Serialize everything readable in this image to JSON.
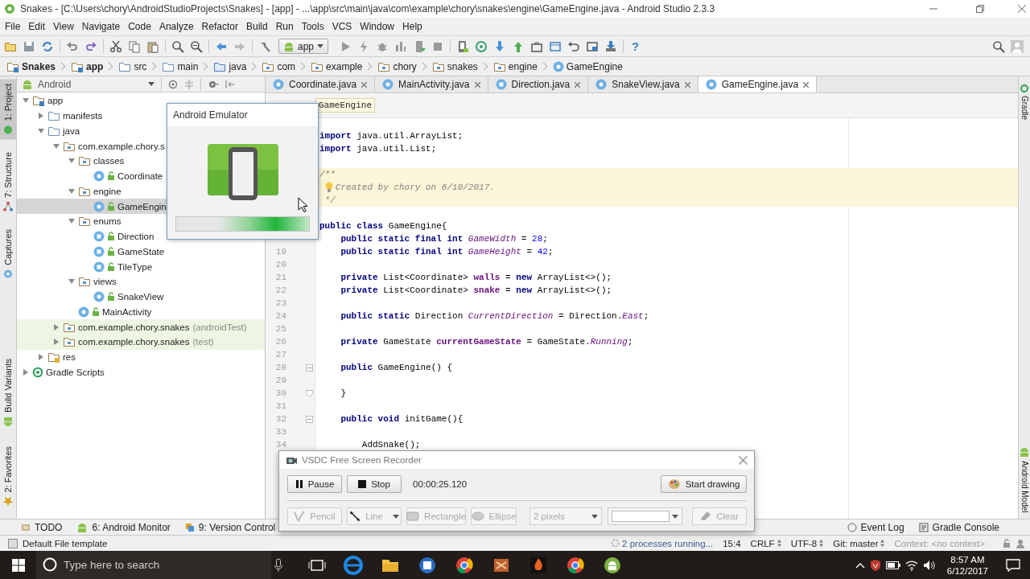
{
  "window": {
    "title": "Snakes - [C:\\Users\\chory\\AndroidStudioProjects\\Snakes] - [app] - ...\\app\\src\\main\\java\\com\\example\\chory\\snakes\\engine\\GameEngine.java - Android Studio 2.3.3"
  },
  "menu": [
    "File",
    "Edit",
    "View",
    "Navigate",
    "Code",
    "Analyze",
    "Refactor",
    "Build",
    "Run",
    "Tools",
    "VCS",
    "Window",
    "Help"
  ],
  "toolbar": {
    "run_config": "app",
    "help": "?"
  },
  "navigation_bar": [
    {
      "label": "Snakes",
      "kind": "project"
    },
    {
      "label": "app",
      "kind": "module"
    },
    {
      "label": "src",
      "kind": "folder"
    },
    {
      "label": "main",
      "kind": "folder"
    },
    {
      "label": "java",
      "kind": "source"
    },
    {
      "label": "com",
      "kind": "package"
    },
    {
      "label": "example",
      "kind": "package"
    },
    {
      "label": "chory",
      "kind": "package"
    },
    {
      "label": "snakes",
      "kind": "package"
    },
    {
      "label": "engine",
      "kind": "package"
    },
    {
      "label": "GameEngine",
      "kind": "class"
    }
  ],
  "tool_strip_left": {
    "top": [
      {
        "label": "1: Project",
        "selected": true
      },
      {
        "label": "7: Structure",
        "selected": false
      },
      {
        "label": "Captures",
        "selected": false
      }
    ],
    "bottom": [
      {
        "label": "Build Variants",
        "selected": false
      },
      {
        "label": "2: Favorites",
        "selected": false
      }
    ]
  },
  "tool_strip_right": {
    "top": [
      "Gradle"
    ],
    "bottom": [
      "Android Model"
    ]
  },
  "project_panel": {
    "view": "Android",
    "tree": [
      {
        "label": "app",
        "kind": "module",
        "expanded": true,
        "selected": false,
        "children": [
          {
            "label": "manifests",
            "kind": "folder",
            "expanded": false,
            "selected": false
          },
          {
            "label": "java",
            "kind": "folder",
            "expanded": true,
            "selected": false,
            "children": [
              {
                "label": "com.example.chory.s",
                "kind": "package",
                "expanded": true,
                "selected": false,
                "children": [
                  {
                    "label": "classes",
                    "kind": "package",
                    "expanded": true,
                    "selected": false,
                    "children": [
                      {
                        "label": "Coordinate",
                        "kind": "class",
                        "selected": false
                      }
                    ]
                  },
                  {
                    "label": "engine",
                    "kind": "package",
                    "expanded": true,
                    "selected": false,
                    "children": [
                      {
                        "label": "GameEngin",
                        "kind": "class",
                        "selected": true
                      }
                    ]
                  },
                  {
                    "label": "enums",
                    "kind": "package",
                    "expanded": true,
                    "selected": false,
                    "children": [
                      {
                        "label": "Direction",
                        "kind": "enum",
                        "selected": false
                      },
                      {
                        "label": "GameState",
                        "kind": "enum",
                        "selected": false
                      },
                      {
                        "label": "TileType",
                        "kind": "enum",
                        "selected": false
                      }
                    ]
                  },
                  {
                    "label": "views",
                    "kind": "package",
                    "expanded": true,
                    "selected": false,
                    "children": [
                      {
                        "label": "SnakeView",
                        "kind": "class",
                        "selected": false
                      }
                    ]
                  },
                  {
                    "label": "MainActivity",
                    "kind": "class",
                    "selected": false
                  }
                ]
              },
              {
                "label": "com.example.chory.snakes",
                "suffix": "(androidTest)",
                "kind": "package",
                "expanded": false,
                "selected": false,
                "highlighted": true
              },
              {
                "label": "com.example.chory.snakes",
                "suffix": "(test)",
                "kind": "package",
                "expanded": false,
                "selected": false,
                "highlighted": true
              }
            ]
          },
          {
            "label": "res",
            "kind": "res",
            "expanded": false,
            "selected": false
          }
        ]
      },
      {
        "label": "Gradle Scripts",
        "kind": "gradle",
        "expanded": false,
        "selected": false
      }
    ]
  },
  "editor": {
    "tabs": [
      {
        "label": "Coordinate.java",
        "kind": "class",
        "selected": false
      },
      {
        "label": "MainActivity.java",
        "kind": "class",
        "selected": false
      },
      {
        "label": "Direction.java",
        "kind": "enum",
        "selected": false
      },
      {
        "label": "SnakeView.java",
        "kind": "class",
        "selected": false
      },
      {
        "label": "GameEngine.java",
        "kind": "class",
        "selected": true
      }
    ],
    "breadcrumb": "GameEngine",
    "lines": [
      {
        "highlighted": false,
        "tokens": [
          {
            "text": "import",
            "kind": "keyword"
          },
          {
            "text": " java.util.ArrayList;",
            "kind": "plain"
          }
        ]
      },
      {
        "highlighted": false,
        "tokens": [
          {
            "text": "import",
            "kind": "keyword"
          },
          {
            "text": " java.util.List;",
            "kind": "plain"
          }
        ]
      },
      {
        "highlighted": false
      },
      {
        "highlighted": true,
        "tokens": [
          {
            "text": "/**",
            "kind": "comment"
          }
        ]
      },
      {
        "highlighted": true,
        "bulb": true,
        "tokens": [
          {
            "text": "   Created by chory on 6/10/2017.",
            "kind": "comment"
          }
        ]
      },
      {
        "highlighted": true,
        "tokens": [
          {
            "text": " */",
            "kind": "comment"
          }
        ]
      },
      {
        "highlighted": false
      },
      {
        "highlighted": false,
        "tokens": [
          {
            "text": "public class",
            "kind": "keyword"
          },
          {
            "text": " GameEngine{",
            "kind": "plain"
          }
        ]
      },
      {
        "highlighted": false,
        "tokens": [
          {
            "text": "    public static final int ",
            "kind": "keyword"
          },
          {
            "text": "GameWidth",
            "kind": "static"
          },
          {
            "text": " = ",
            "kind": "plain"
          },
          {
            "text": "28",
            "kind": "number"
          },
          {
            "text": ";",
            "kind": "plain"
          }
        ]
      },
      {
        "number": "19",
        "highlighted": false,
        "tokens": [
          {
            "text": "    public static final int ",
            "kind": "keyword"
          },
          {
            "text": "GameHeight",
            "kind": "static"
          },
          {
            "text": " = ",
            "kind": "plain"
          },
          {
            "text": "42",
            "kind": "number"
          },
          {
            "text": ";",
            "kind": "plain"
          }
        ]
      },
      {
        "number": "20",
        "highlighted": false
      },
      {
        "number": "21",
        "highlighted": false,
        "tokens": [
          {
            "text": "    private",
            "kind": "keyword"
          },
          {
            "text": " List<Coordinate> ",
            "kind": "plain"
          },
          {
            "text": "walls",
            "kind": "field"
          },
          {
            "text": " = ",
            "kind": "plain"
          },
          {
            "text": "new",
            "kind": "keyword"
          },
          {
            "text": " ArrayList<>();",
            "kind": "plain"
          }
        ]
      },
      {
        "number": "22",
        "highlighted": false,
        "tokens": [
          {
            "text": "    private",
            "kind": "keyword"
          },
          {
            "text": " List<Coordinate> ",
            "kind": "plain"
          },
          {
            "text": "snake",
            "kind": "field"
          },
          {
            "text": " = ",
            "kind": "plain"
          },
          {
            "text": "new",
            "kind": "keyword"
          },
          {
            "text": " ArrayList<>();",
            "kind": "plain"
          }
        ]
      },
      {
        "number": "23",
        "highlighted": false
      },
      {
        "number": "24",
        "highlighted": false,
        "tokens": [
          {
            "text": "    public static",
            "kind": "keyword"
          },
          {
            "text": " Direction ",
            "kind": "plain"
          },
          {
            "text": "CurrentDirection",
            "kind": "static"
          },
          {
            "text": " = Direction.",
            "kind": "plain"
          },
          {
            "text": "East",
            "kind": "static"
          },
          {
            "text": ";",
            "kind": "plain"
          }
        ]
      },
      {
        "number": "25",
        "highlighted": false
      },
      {
        "number": "26",
        "highlighted": false,
        "tokens": [
          {
            "text": "    private",
            "kind": "keyword"
          },
          {
            "text": " GameState ",
            "kind": "plain"
          },
          {
            "text": "currentGameState",
            "kind": "field"
          },
          {
            "text": " = GameState.",
            "kind": "plain"
          },
          {
            "text": "Running",
            "kind": "static"
          },
          {
            "text": ";",
            "kind": "plain"
          }
        ]
      },
      {
        "number": "27",
        "highlighted": false
      },
      {
        "number": "28",
        "highlighted": false,
        "fold_open": true,
        "tokens": [
          {
            "text": "    public",
            "kind": "keyword"
          },
          {
            "text": " GameEngine() {",
            "kind": "plain"
          }
        ]
      },
      {
        "number": "29",
        "highlighted": false
      },
      {
        "number": "30",
        "highlighted": false,
        "fold_close": true,
        "tokens": [
          {
            "text": "    }",
            "kind": "plain"
          }
        ]
      },
      {
        "number": "31",
        "highlighted": false
      },
      {
        "number": "32",
        "highlighted": false,
        "fold_open": true,
        "tokens": [
          {
            "text": "    public void",
            "kind": "keyword"
          },
          {
            "text": " initGame(){",
            "kind": "plain"
          }
        ]
      },
      {
        "number": "33",
        "highlighted": false
      },
      {
        "number": "34",
        "highlighted": false,
        "tokens": [
          {
            "text": "        AddSnake();",
            "kind": "plain"
          }
        ]
      }
    ]
  },
  "bottom_tool_tabs": {
    "left": [
      {
        "label": "TODO",
        "kind": "todo"
      },
      {
        "label": "6: Android Monitor",
        "kind": "monitor"
      },
      {
        "label": "9: Version Control",
        "kind": "vcs"
      }
    ],
    "right": [
      {
        "label": "Event Log",
        "kind": "log"
      },
      {
        "label": "Gradle Console",
        "kind": "console"
      }
    ]
  },
  "status_bar": {
    "message": "Default File template",
    "progress": "2 processes running...",
    "position": "15:4",
    "line_separator": "CRLF",
    "encoding": "UTF-8",
    "vcs": "Git: master",
    "context": "Context: <no context>"
  },
  "taskbar": {
    "search": {
      "placeholder": "Type here to search"
    },
    "time": "8:57 AM",
    "date": "6/12/2017"
  },
  "emulator_popup": {
    "title": "Android Emulator"
  },
  "recorder": {
    "title": "VSDC Free Screen Recorder",
    "elapsed": "00:00:25.120",
    "buttons": [
      {
        "label": "Pause",
        "kind": "pause",
        "disabled": false
      },
      {
        "label": "Stop",
        "kind": "stop",
        "disabled": false
      },
      {
        "label": "Start drawing",
        "kind": "draw",
        "disabled": false
      }
    ],
    "tools": [
      {
        "label": "Pencil",
        "kind": "pencil",
        "disabled": true
      },
      {
        "label": "Line",
        "kind": "line",
        "disabled": true
      },
      {
        "label": "Rectangle",
        "kind": "rectangle",
        "disabled": true
      },
      {
        "label": "Ellipse",
        "kind": "ellipse",
        "disabled": true
      },
      {
        "value": "2 pixels",
        "kind": "width",
        "disabled": true
      },
      {
        "kind": "color",
        "disabled": true
      },
      {
        "label": "Clear",
        "kind": "clear",
        "disabled": true
      }
    ]
  }
}
